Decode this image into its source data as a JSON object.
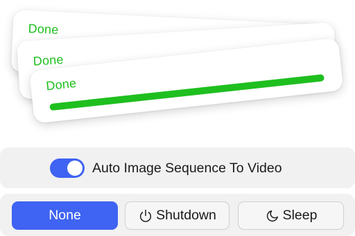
{
  "cards": [
    {
      "status": "Done"
    },
    {
      "status": "Done"
    },
    {
      "status": "Done",
      "progress": 1.0
    }
  ],
  "toggle": {
    "label": "Auto Image Sequence To Video",
    "on": true
  },
  "actions": {
    "none_label": "None",
    "shutdown_label": "Shutdown",
    "sleep_label": "Sleep",
    "selected": "None",
    "shutdown_icon": "power-icon",
    "sleep_icon": "moon-icon"
  },
  "colors": {
    "accent": "#3f63f2",
    "success": "#1fbf1f",
    "panel": "#f1f1f1"
  }
}
